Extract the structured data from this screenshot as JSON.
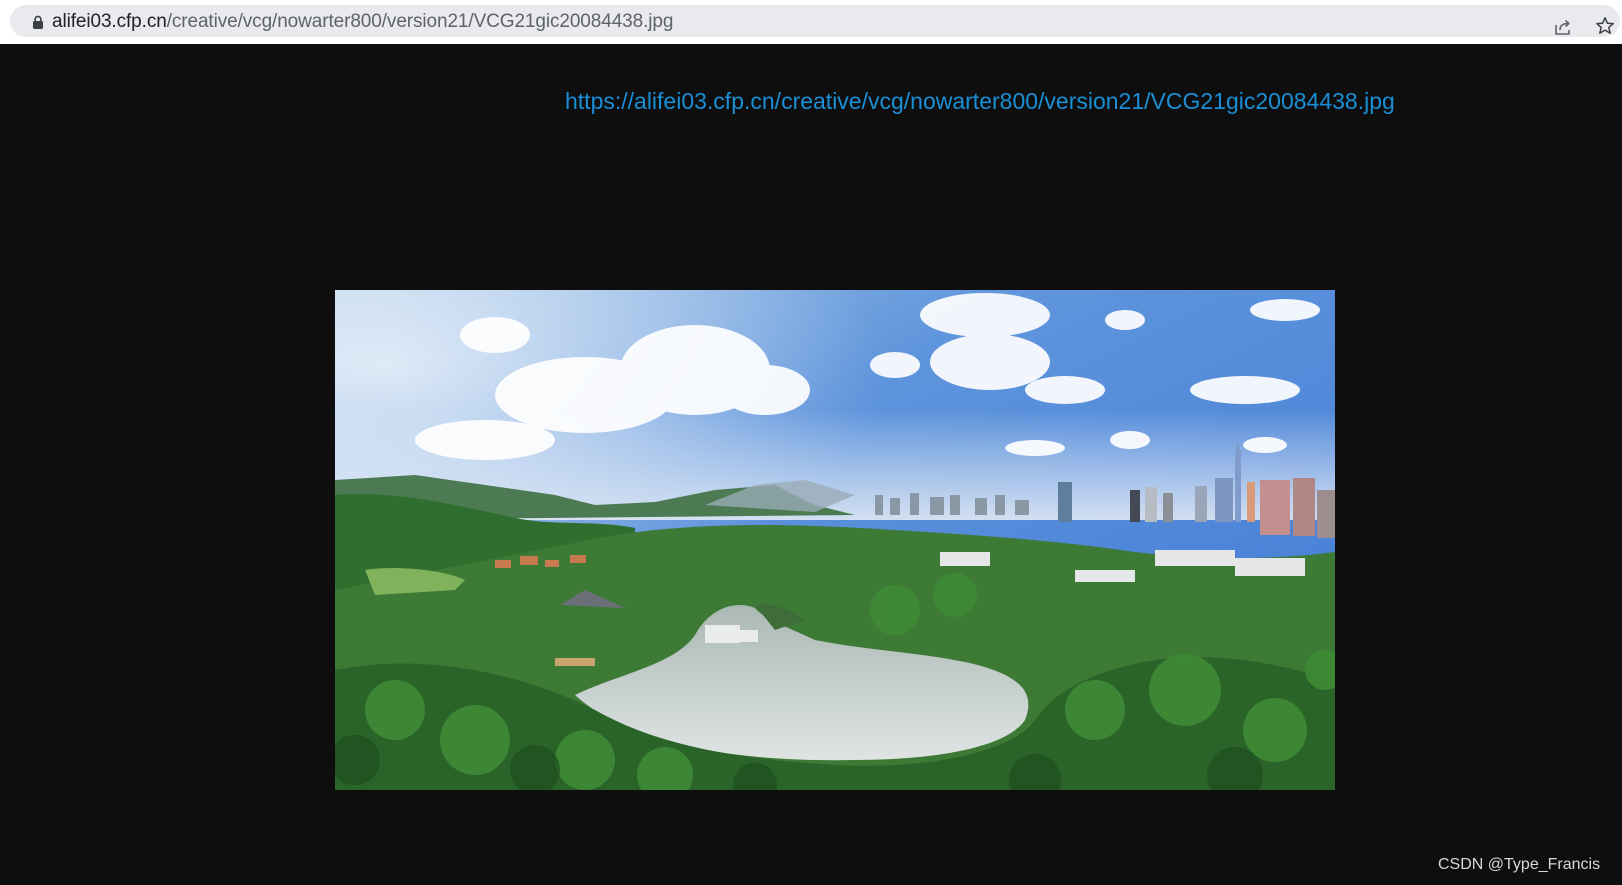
{
  "address_bar": {
    "host": "alifei03.cfp.cn",
    "path": "/creative/vcg/nowarter800/version21/VCG21gic20084438.jpg",
    "icons": [
      "lock-icon",
      "share-icon",
      "star-icon"
    ]
  },
  "page": {
    "image_url_link": "https://alifei03.cfp.cn/creative/vcg/nowarter800/version21/VCG21gic20084438.jpg",
    "watermark": "CSDN @Type_Francis"
  },
  "colors": {
    "page_background": "#0e0e0e",
    "link": "#1a8fd6",
    "omnibox": "#e9eaed"
  }
}
